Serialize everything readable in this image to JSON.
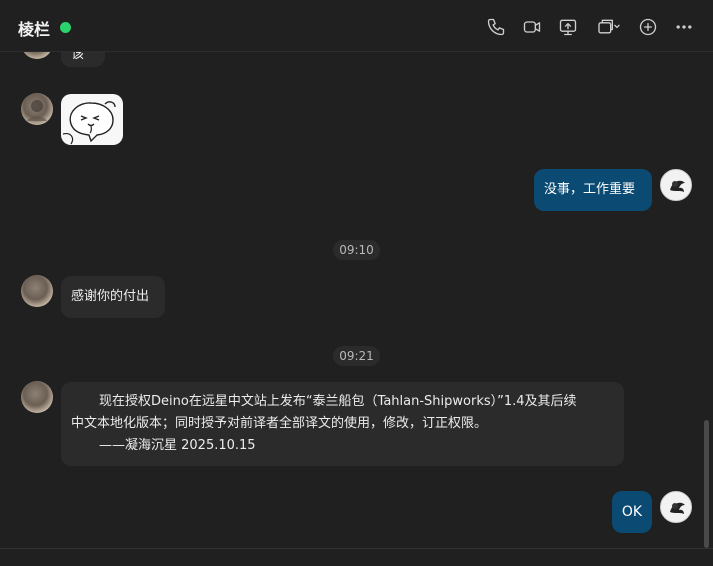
{
  "header": {
    "title": "棱栏",
    "status_color": "#2ad36b",
    "icons": [
      "phone-icon",
      "video-call-icon",
      "screen-share-icon",
      "window-dropdown-icon",
      "add-icon",
      "more-icon"
    ]
  },
  "messages": {
    "partial_text": "该",
    "reply_1": "没事，工作重要",
    "time_1": "09:10",
    "thanks": "感谢你的付出",
    "time_2": "09:21",
    "long_line_1": "现在授权Deino在远星中文站上发布“泰兰船包（Tahlan-Shipworks）”1.4及其后续",
    "long_line_2": "中文本地化版本；同时授予对前译者全部译文的使用，修改，订正权限。",
    "long_line_3": "——凝海沉星 2025.10.15",
    "reply_2": "OK"
  },
  "colors": {
    "outgoing_bubble": "#0b4a72",
    "incoming_bubble": "#2b2b2b",
    "background": "#202020"
  }
}
